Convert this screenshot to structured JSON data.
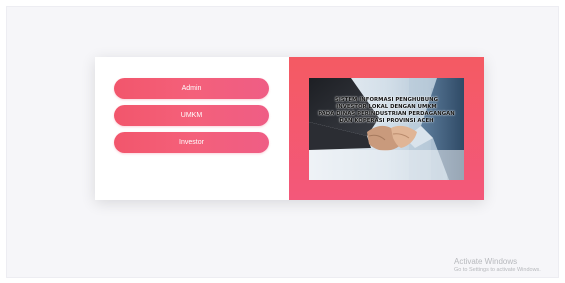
{
  "roles": {
    "admin_label": "Admin",
    "umkm_label": "UMKM",
    "investor_label": "Investor"
  },
  "hero": {
    "caption_lines": [
      "SISTEM INFORMASI PENGHUBUNG",
      "INVESTOR LOKAL DENGAN UMKM",
      "PADA DINAS PERINDUSTRIAN PERDAGANGAN",
      "DAN KOPERASI PROVINSI ACEH"
    ],
    "image_subject": "handshake"
  },
  "watermark": {
    "title": "Activate Windows",
    "subtitle": "Go to Settings to activate Windows."
  },
  "colors": {
    "accent": "#f35a6f",
    "page_background": "#f6f6f9",
    "card_background": "#ffffff"
  }
}
